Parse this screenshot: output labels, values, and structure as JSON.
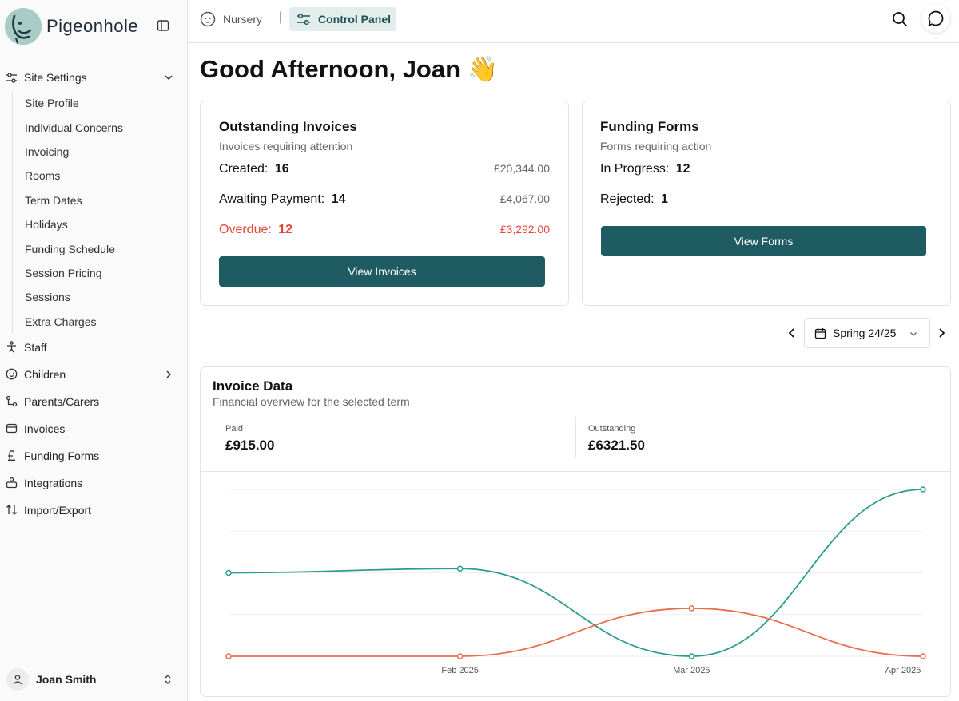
{
  "app": {
    "brand": "Pigeonhole"
  },
  "sidebar": {
    "site_settings": {
      "label": "Site Settings",
      "items": [
        "Site Profile",
        "Individual Concerns",
        "Invoicing",
        "Rooms",
        "Term Dates",
        "Holidays",
        "Funding Schedule",
        "Session Pricing",
        "Sessions",
        "Extra Charges"
      ]
    },
    "items": {
      "staff": "Staff",
      "children": "Children",
      "parents": "Parents/Carers",
      "invoices": "Invoices",
      "funding_forms": "Funding Forms",
      "integrations": "Integrations",
      "import_export": "Import/Export"
    },
    "user": {
      "name": "Joan Smith"
    }
  },
  "topbar": {
    "nursery": "Nursery",
    "separator": "|",
    "control_panel": "Control Panel"
  },
  "greeting": {
    "text": "Good Afternoon, Joan",
    "emoji": "👋"
  },
  "outstanding_invoices": {
    "title": "Outstanding Invoices",
    "subtitle": "Invoices requiring attention",
    "created_label": "Created:",
    "created_count": "16",
    "created_amount": "£20,344.00",
    "awaiting_label": "Awaiting Payment:",
    "awaiting_count": "14",
    "awaiting_amount": "£4,067.00",
    "overdue_label": "Overdue:",
    "overdue_count": "12",
    "overdue_amount": "£3,292.00",
    "button": "View Invoices"
  },
  "funding_forms": {
    "title": "Funding Forms",
    "subtitle": "Forms requiring action",
    "in_progress_label": "In Progress:",
    "in_progress_count": "12",
    "rejected_label": "Rejected:",
    "rejected_count": "1",
    "button": "View Forms"
  },
  "term": {
    "selected": "Spring 24/25"
  },
  "invoice_data": {
    "title": "Invoice Data",
    "subtitle": "Financial overview for the selected term",
    "paid_label": "Paid",
    "paid_value": "£915.00",
    "outstanding_label": "Outstanding",
    "outstanding_value": "£6321.50"
  },
  "colors": {
    "primary": "#1e5b63",
    "teal_series": "#2a9d8f",
    "orange_series": "#e76f51",
    "overdue_red": "#e5483a"
  },
  "chart_data": {
    "type": "line",
    "categories": [
      "",
      "Feb 2025",
      "Mar 2025",
      "Apr 2025"
    ],
    "series": [
      {
        "values": [
          2000,
          2100,
          0,
          4000
        ],
        "color": "#2a9d8f"
      },
      {
        "values": [
          0,
          0,
          1150,
          0
        ],
        "color": "#e76f51"
      }
    ],
    "ylim": [
      0,
      4000
    ],
    "grid": true
  }
}
